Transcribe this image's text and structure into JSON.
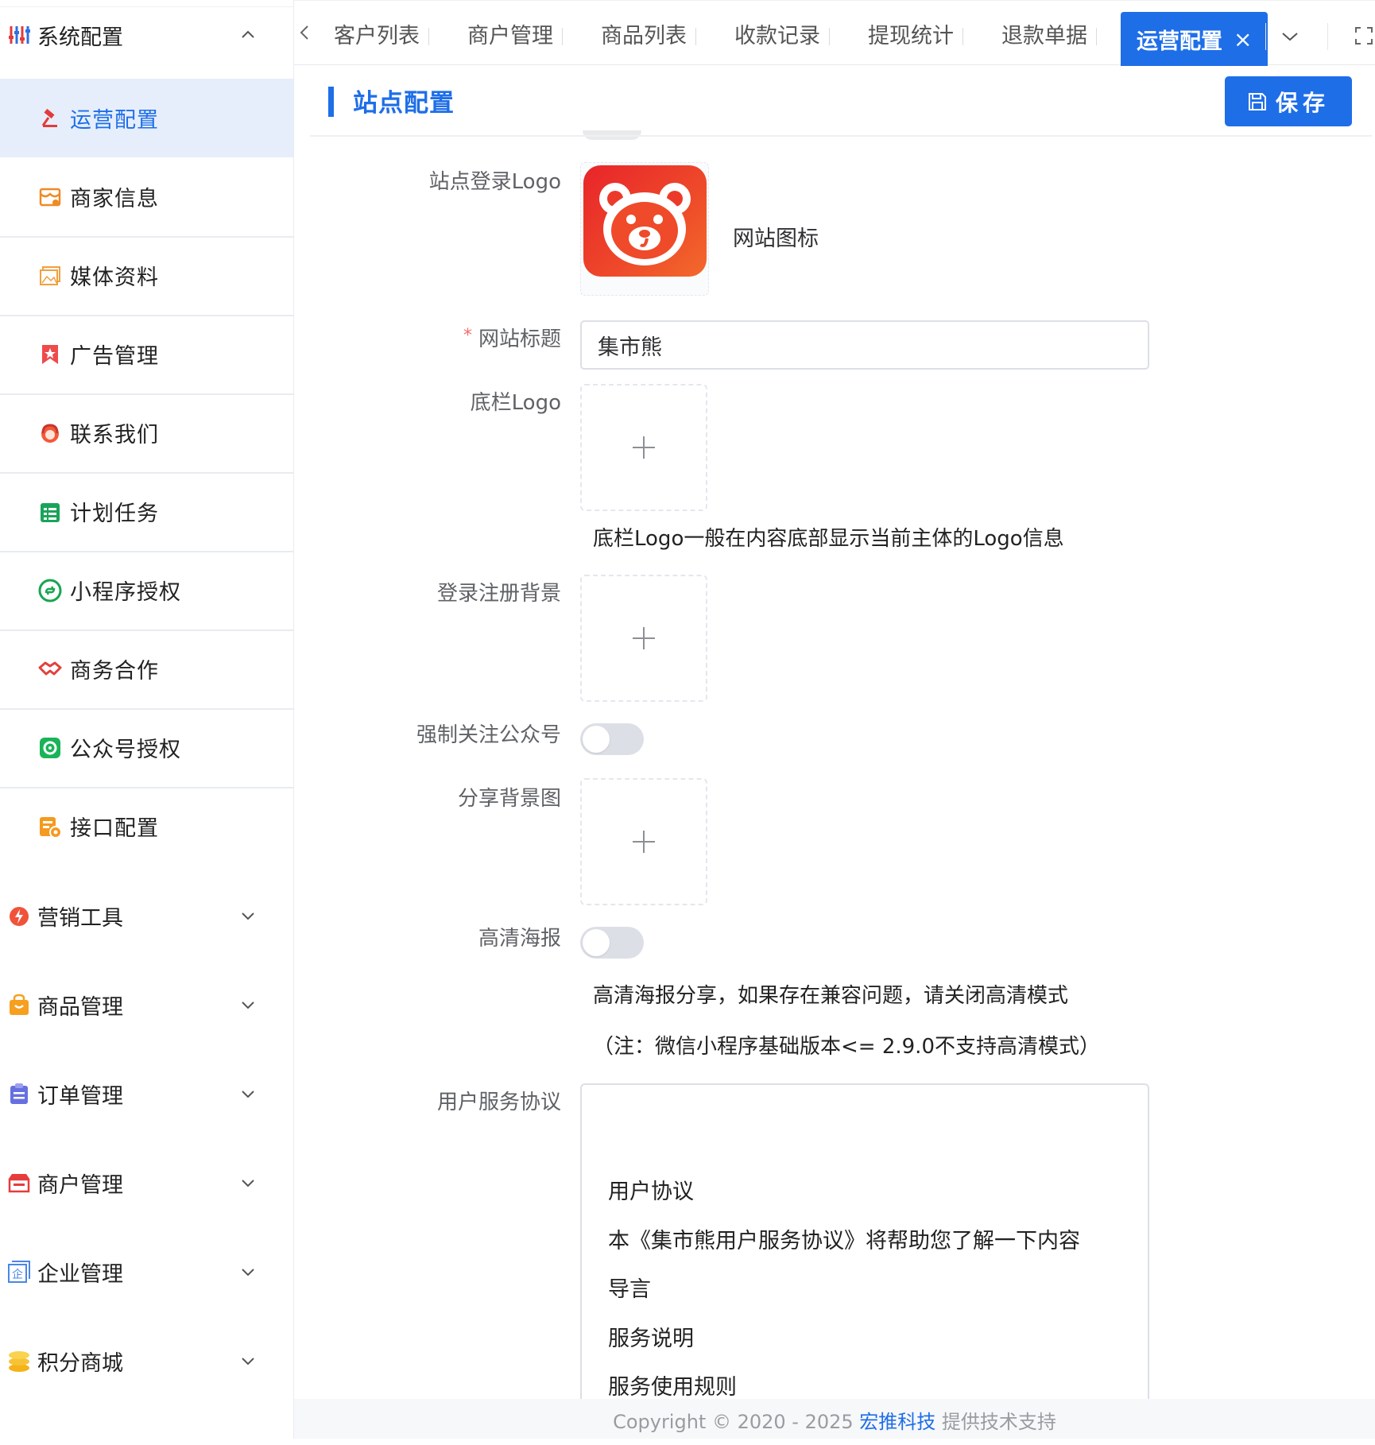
{
  "sidebar": {
    "group_system": {
      "label": "系统配置",
      "icon": "sliders-icon",
      "expanded": true
    },
    "sub_items": [
      {
        "label": "运营配置",
        "icon": "hammer-icon",
        "active": true
      },
      {
        "label": "商家信息",
        "icon": "store-icon"
      },
      {
        "label": "媒体资料",
        "icon": "image-icon"
      },
      {
        "label": "广告管理",
        "icon": "ad-bookmark-icon"
      },
      {
        "label": "联系我们",
        "icon": "headset-icon"
      },
      {
        "label": "计划任务",
        "icon": "task-list-icon"
      },
      {
        "label": "小程序授权",
        "icon": "miniprogram-icon"
      },
      {
        "label": "商务合作",
        "icon": "handshake-icon"
      },
      {
        "label": "公众号授权",
        "icon": "wechat-account-icon"
      },
      {
        "label": "接口配置",
        "icon": "api-config-icon"
      }
    ],
    "groups": [
      {
        "label": "营销工具",
        "icon": "marketing-icon"
      },
      {
        "label": "商品管理",
        "icon": "bag-icon"
      },
      {
        "label": "订单管理",
        "icon": "clipboard-icon"
      },
      {
        "label": "商户管理",
        "icon": "shop-icon"
      },
      {
        "label": "企业管理",
        "icon": "enterprise-icon"
      },
      {
        "label": "积分商城",
        "icon": "coins-icon"
      }
    ]
  },
  "tabs": {
    "items": [
      "客户列表",
      "商户管理",
      "商品列表",
      "收款记录",
      "提现统计",
      "退款单据"
    ],
    "active": "运营配置",
    "close_glyph": "×"
  },
  "section": {
    "title": "站点配置",
    "save_label": "保存"
  },
  "form": {
    "login_logo_label": "站点登录Logo",
    "favicon_text": "网站图标",
    "site_title_label": "网站标题",
    "site_title_required": "*",
    "site_title_value": "集市熊",
    "footer_logo_label": "底栏Logo",
    "footer_logo_tip": "底栏Logo一般在内容底部显示当前主体的Logo信息",
    "login_bg_label": "登录注册背景",
    "force_follow_label": "强制关注公众号",
    "force_follow_on": false,
    "share_bg_label": "分享背景图",
    "hd_poster_label": "高清海报",
    "hd_poster_on": false,
    "hd_tip_1": "高清海报分享，如果存在兼容问题，请关闭高清模式",
    "hd_tip_2": "（注：微信小程序基础版本<= 2.9.0不支持高清模式）",
    "agreement_label": "用户服务协议",
    "agreement_lines": [
      "用户协议",
      "本《集市熊用户服务协议》将帮助您了解一下内容",
      "导言",
      "服务说明",
      "服务使用规则"
    ]
  },
  "footer": {
    "prefix": "Copyright © 2020 - 2025 ",
    "brand": "宏推科技",
    "suffix": " 提供技术支持"
  },
  "colors": {
    "accent": "#1e6ee8",
    "active_bg": "#e6eefb",
    "logo_red": "#e8242a",
    "logo_orange": "#f36a2b"
  }
}
